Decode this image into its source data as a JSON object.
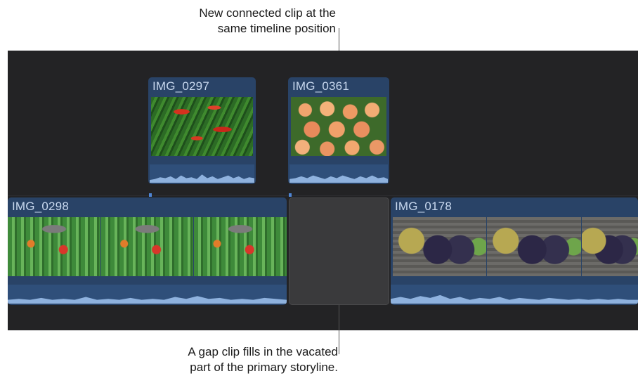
{
  "callouts": {
    "top": [
      "New connected clip at the",
      "same timeline position"
    ],
    "bottom": [
      "A gap clip fills in the vacated",
      "part of the primary storyline."
    ]
  },
  "connected_clips": [
    {
      "name": "IMG_0297",
      "thumbnail": "green and red peppers"
    },
    {
      "name": "IMG_0361",
      "thumbnail": "peaches"
    }
  ],
  "primary_storyline": [
    {
      "name": "IMG_0298",
      "thumbnail": "market produce on pavement"
    },
    {
      "type": "gap clip"
    },
    {
      "name": "IMG_0178",
      "thumbnail": "grapes and vegetables"
    }
  ],
  "colors": {
    "timeline_bg": "#232325",
    "clip_header": "#294367",
    "clip_label": "#c9d9ef",
    "audio_wave": "#8fb2de",
    "gap_clip": "#3a3a3c",
    "connection_marker": "#4f86d6"
  }
}
